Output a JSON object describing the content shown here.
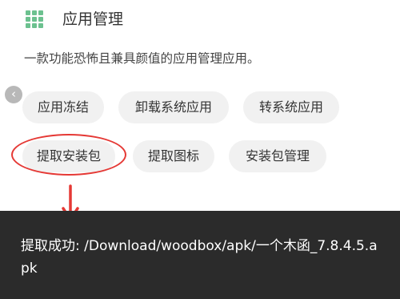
{
  "header": {
    "icon": "grid-apps-icon",
    "title": "应用管理"
  },
  "description": "一款功能恐怖且兼具颜值的应用管理应用。",
  "buttons": {
    "freeze": "应用冻结",
    "uninstall_system": "卸载系统应用",
    "to_system": "转系统应用",
    "extract_apk": "提取安装包",
    "extract_icon": "提取图标",
    "apk_manage": "安装包管理"
  },
  "toast": {
    "message": "提取成功: /Download/woodbox/apk/一个木函_7.8.4.5.apk"
  },
  "colors": {
    "accent_green": "#6cc18f",
    "annotation_red": "#e53935",
    "toast_bg": "#2b2b2b"
  }
}
